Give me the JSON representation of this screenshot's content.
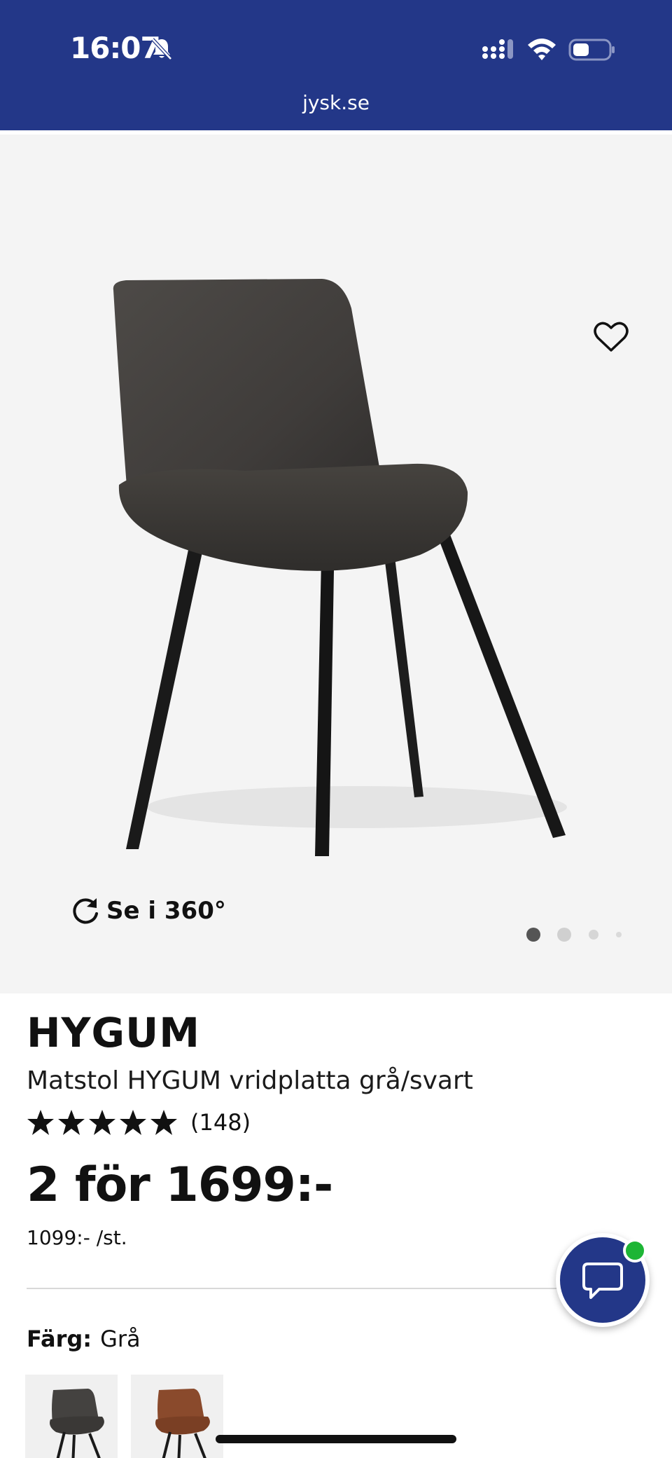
{
  "status_bar": {
    "time": "16:07"
  },
  "browser": {
    "url": "jysk.se"
  },
  "gallery": {
    "view_360_label": "Se i 360°",
    "active_slide": 1,
    "slide_count": 4
  },
  "product": {
    "brand": "HYGUM",
    "name": "Matstol HYGUM vridplatta grå/svart",
    "rating_stars": 5,
    "review_count": "(148)",
    "price": "2 för 1699:-",
    "unit_price": "1099:- /st."
  },
  "color": {
    "label": "Färg:",
    "value": "Grå",
    "swatches": [
      "grey",
      "brown"
    ]
  },
  "colors": {
    "brand_blue": "#233788",
    "online_green": "#1db535"
  },
  "icons": [
    "bell-slash-icon",
    "signal-icon",
    "wifi-icon",
    "battery-icon",
    "heart-icon",
    "rotate-360-icon",
    "star-icon",
    "chat-icon"
  ]
}
